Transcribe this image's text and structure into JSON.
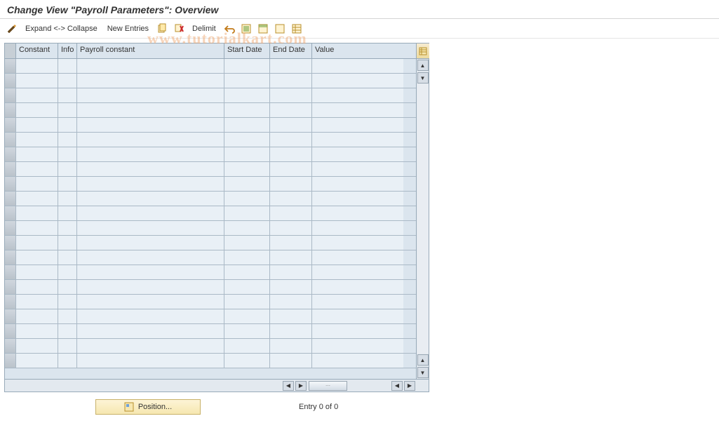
{
  "title": "Change View \"Payroll Parameters\": Overview",
  "toolbar": {
    "expand_label": "Expand <-> Collapse",
    "new_entries_label": "New Entries",
    "delimit_label": "Delimit"
  },
  "grid": {
    "columns": {
      "constant": "Constant",
      "info": "Info",
      "payroll_constant": "Payroll constant",
      "start_date": "Start Date",
      "end_date": "End Date",
      "value": "Value"
    },
    "row_count": 21
  },
  "footer": {
    "position_label": "Position...",
    "entry_status": "Entry 0 of 0"
  },
  "watermark": "www.tutorialkart.com"
}
